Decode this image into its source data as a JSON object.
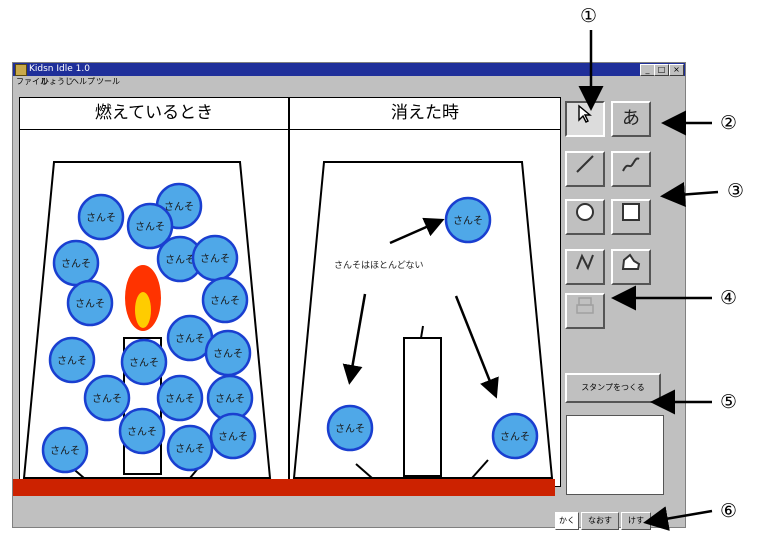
{
  "window": {
    "title": "Kidsn Idle 1.0",
    "menu": [
      "ファイル",
      "ひょうじ",
      "ヘルプ",
      "ツール"
    ]
  },
  "panels": {
    "left_header": "燃えているとき",
    "right_header": "消えた時",
    "oxygen_label": "さんそ",
    "right_note": "さんそはほとんどない"
  },
  "tools": {
    "select": "select-arrow-icon",
    "text": "あ",
    "line": "line-icon",
    "freehand": "freehand-icon",
    "circle": "circle-icon",
    "rectangle": "rectangle-icon",
    "polyline": "polyline-icon",
    "polygon": "polygon-icon",
    "print": "print-icon"
  },
  "stamp_button": "スタンプをつくる",
  "bottom_tabs": [
    "かく",
    "なおす",
    "けす"
  ],
  "callouts": [
    "①",
    "②",
    "③",
    "④",
    "⑤",
    "⑥"
  ],
  "colors": {
    "titlebar": "#1f2f9a",
    "oxygen_fill": "#4fa8e8",
    "oxygen_stroke": "#1a3fd0",
    "flame_outer": "#ff3300",
    "flame_inner": "#ffcc00",
    "floor": "#cc2200"
  }
}
